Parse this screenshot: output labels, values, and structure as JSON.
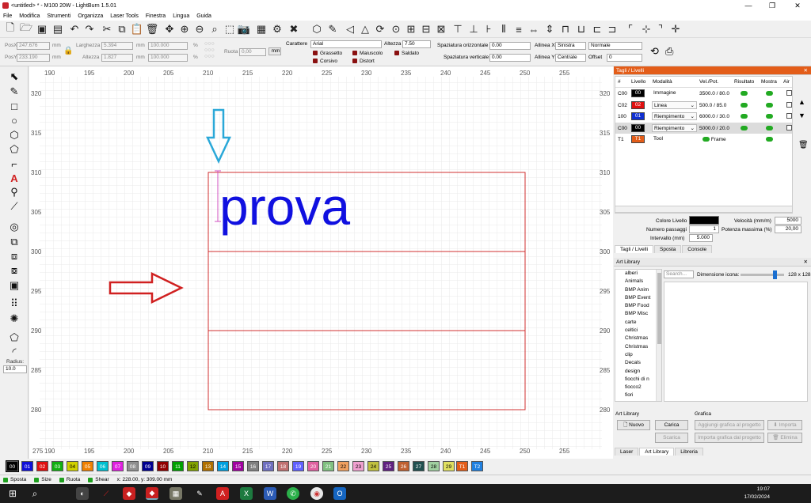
{
  "window": {
    "title": "<untitled> * - M100 20W - LightBurn 1.5.01",
    "min": "—",
    "max": "❐",
    "close": "✕"
  },
  "menu": [
    "File",
    "Modifica",
    "Strumenti",
    "Organizza",
    "Laser Tools",
    "Finestra",
    "Lingua",
    "Guida"
  ],
  "position": {
    "posx_label": "PosX",
    "posx": "247.676",
    "posy_label": "PosY",
    "posy": "233.190",
    "unit": "mm",
    "width_label": "Larghezza",
    "width": "5.394",
    "height_label": "Altezza",
    "height": "1.827",
    "scale_w": "100.000",
    "scale_h": "100.000",
    "pct": "%",
    "rotate_label": "Ruota",
    "rotate": "0,00",
    "mm_button": "mm"
  },
  "text_tools": {
    "font_label": "Carattere",
    "font": "Arial",
    "height_label": "Altezza",
    "height": "7.50",
    "bold": "Grassetto",
    "italic": "Corsivo",
    "upper": "Maiuscolo",
    "distort": "Distort",
    "welded": "Saldato",
    "hspace_label": "Spaziatura orizzontale",
    "hspace": "0.00",
    "vspace_label": "Spaziatura verticale",
    "vspace": "0.00",
    "alignx_label": "Allinea X",
    "alignx": "Sinistra",
    "aligny_label": "Allinea Y",
    "aligny": "Centrale",
    "mode": "Normale",
    "offset_label": "Offset",
    "offset": "0"
  },
  "left_radius": {
    "label": "Radius:",
    "value": "10.0"
  },
  "ruler": {
    "top": [
      "190",
      "195",
      "200",
      "205",
      "210",
      "215",
      "220",
      "225",
      "230",
      "235",
      "240",
      "245",
      "250",
      "255"
    ],
    "left": [
      "320",
      "315",
      "310",
      "305",
      "300",
      "295",
      "290",
      "285",
      "280"
    ],
    "corner_bottom": "275"
  },
  "canvas_text": "prova",
  "cuts_panel": {
    "title": "Tagli / Livelli",
    "headers": [
      "#",
      "Livello",
      "Modalità",
      "Vel./Pot.",
      "Risultato",
      "Mostra",
      "Air"
    ],
    "rows": [
      {
        "id": "C00",
        "layer": "00",
        "color": "#000000",
        "mode": "Immagine",
        "speed": "3500.0 / 80.0",
        "dropdown": false
      },
      {
        "id": "C02",
        "layer": "02",
        "color": "#e01010",
        "mode": "Linea",
        "speed": "500.0 / 85.0",
        "dropdown": true
      },
      {
        "id": "100",
        "layer": "01",
        "color": "#1030d0",
        "mode": "Riempimento",
        "speed": "6000.0 / 30.0",
        "dropdown": true
      },
      {
        "id": "C00",
        "layer": "00",
        "color": "#000000",
        "mode": "Riempimento",
        "speed": "5000.0 / 20.0",
        "dropdown": true
      },
      {
        "id": "T1",
        "layer": "T1",
        "color": "#e35d19",
        "mode": "Tool",
        "speed": "Frame",
        "dropdown": false
      }
    ],
    "layer_color_label": "Colore Livello",
    "speed_label": "Velocità (mm/m)",
    "speed": "5000",
    "passes_label": "Numero passaggi",
    "passes": "1",
    "maxpower_label": "Potenza massima (%)",
    "maxpower": "20,00",
    "interval_label": "Intervallo (mm)",
    "interval": "5.000",
    "tabs": [
      "Tagli / Livelli",
      "Sposta",
      "Console"
    ]
  },
  "art_library": {
    "title": "Art Library",
    "search_placeholder": "Search...",
    "icon_size_label": "Dimensione icona:",
    "icon_size": "128 x 128",
    "icon_size_level": 0.82,
    "items": [
      "alberi",
      "Animals",
      "BMP Anim",
      "BMP Event",
      "BMP Food",
      "BMP Misc",
      "carte",
      "celtici",
      "Christmas",
      "Christmas",
      "clip",
      "Decals",
      "design",
      "fiocchi di n",
      "fiocco2",
      "fiori"
    ],
    "group_library": "Art Library",
    "group_graphic": "Grafica",
    "btn_new": "Nuovo",
    "btn_load": "Carica",
    "btn_unload": "Scarica",
    "btn_add": "Aggiungi grafica al progetto",
    "btn_import": "Importa",
    "btn_import_from": "Importa grafica dal progetto",
    "btn_delete": "Elimina",
    "tabs": [
      "Laser",
      "Art Library",
      "Libreria"
    ]
  },
  "palette": [
    {
      "t": "00",
      "c": "#000000"
    },
    {
      "t": "01",
      "c": "#1010d8"
    },
    {
      "t": "02",
      "c": "#e01010"
    },
    {
      "t": "03",
      "c": "#10b010"
    },
    {
      "t": "04",
      "c": "#d0d000"
    },
    {
      "t": "05",
      "c": "#f08000"
    },
    {
      "t": "06",
      "c": "#00c0d0"
    },
    {
      "t": "07",
      "c": "#e020e0"
    },
    {
      "t": "08",
      "c": "#909090"
    },
    {
      "t": "09",
      "c": "#000090"
    },
    {
      "t": "10",
      "c": "#900000"
    },
    {
      "t": "11",
      "c": "#00a000"
    },
    {
      "t": "12",
      "c": "#80a000"
    },
    {
      "t": "13",
      "c": "#b07000"
    },
    {
      "t": "14",
      "c": "#00a0e0"
    },
    {
      "t": "15",
      "c": "#a000a0"
    },
    {
      "t": "16",
      "c": "#808080"
    },
    {
      "t": "17",
      "c": "#7070c0"
    },
    {
      "t": "18",
      "c": "#c07070"
    },
    {
      "t": "19",
      "c": "#6060ff"
    },
    {
      "t": "20",
      "c": "#e060a0"
    },
    {
      "t": "21",
      "c": "#80c080"
    },
    {
      "t": "22",
      "c": "#f0a060"
    },
    {
      "t": "23",
      "c": "#f0a0d0"
    },
    {
      "t": "24",
      "c": "#c0c040"
    },
    {
      "t": "25",
      "c": "#602080"
    },
    {
      "t": "26",
      "c": "#c06030"
    },
    {
      "t": "27",
      "c": "#205050"
    },
    {
      "t": "28",
      "c": "#a0d0a0"
    },
    {
      "t": "29",
      "c": "#e0e060"
    },
    {
      "t": "T1",
      "c": "#e35d19"
    },
    {
      "t": "T2",
      "c": "#2080e0"
    }
  ],
  "status": {
    "move": "Sposta",
    "size": "Size",
    "rotate": "Ruota",
    "shear": "Shear",
    "coords": "x: 228.00, y: 309.00 mm"
  },
  "taskbar": {
    "time": "19:07",
    "date": "17/02/2024"
  }
}
